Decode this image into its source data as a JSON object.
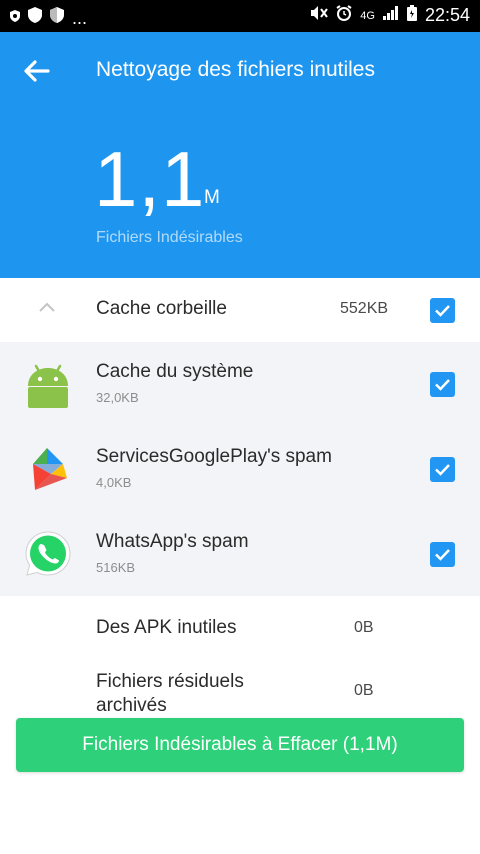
{
  "status_bar": {
    "dots": "...",
    "network": "4G",
    "time": "22:54"
  },
  "header": {
    "title": "Nettoyage des fichiers inutiles",
    "total_size": "1,1",
    "total_unit": "M",
    "subtitle": "Fichiers Indésirables"
  },
  "cache_section": {
    "label": "Cache corbeille",
    "size": "552KB",
    "checked": true,
    "items": [
      {
        "label": "Cache du système",
        "size": "32,0KB",
        "icon": "android-icon",
        "checked": true
      },
      {
        "label": "ServicesGooglePlay's spam",
        "size": "4,0KB",
        "icon": "google-play-services-icon",
        "checked": true
      },
      {
        "label": "WhatsApp's spam",
        "size": "516KB",
        "icon": "whatsapp-icon",
        "checked": true
      }
    ]
  },
  "other_sections": [
    {
      "label": "Des APK inutiles",
      "size": "0B"
    },
    {
      "label": "Fichiers résiduels archivés",
      "size": "0B"
    }
  ],
  "action_button": {
    "label": "Fichiers Indésirables à Effacer (1,1M)"
  },
  "colors": {
    "header_bg": "#1e96f0",
    "checkbox": "#2196f3",
    "button": "#2fd07a",
    "item_bg": "#f3f4f8"
  }
}
